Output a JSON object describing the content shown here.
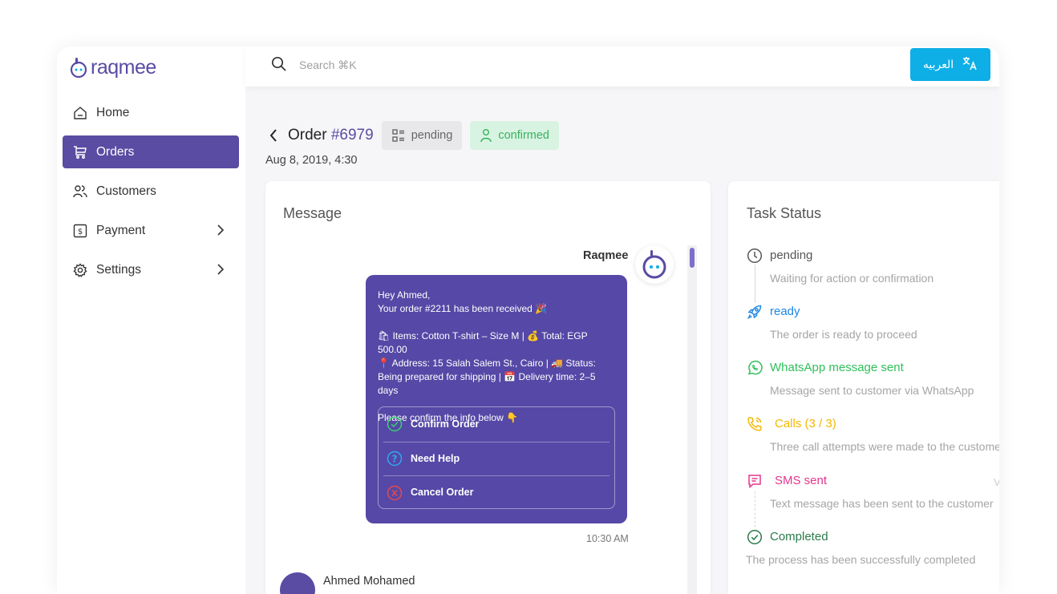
{
  "app": {
    "logo_text": "raqmee"
  },
  "sidebar": {
    "items": [
      {
        "label": "Home",
        "icon": "home-icon",
        "active": false
      },
      {
        "label": "Orders",
        "icon": "cart-icon",
        "active": true
      },
      {
        "label": "Customers",
        "icon": "users-icon",
        "active": false
      },
      {
        "label": "Payment",
        "icon": "dollar-receipt-icon",
        "active": false,
        "has_submenu": true
      },
      {
        "label": "Settings",
        "icon": "gear-icon",
        "active": false,
        "has_submenu": true
      }
    ]
  },
  "topbar": {
    "search_placeholder": "Search ⌘K",
    "language_button": "العربيه"
  },
  "order": {
    "title_prefix": "Order",
    "number": "#6979",
    "status_pending": "pending",
    "status_confirmed": "confirmed",
    "date": "Aug 8, 2019, 4:30"
  },
  "message_card": {
    "title": "Message",
    "sender": "Raqmee",
    "bubble": {
      "greeting": "Hey Ahmed,",
      "line1": "Your order #2211 has been received 🎉",
      "line2": "🛍 Items: Cotton T-shirt – Size M | 💰 Total: EGP 500.00",
      "line3": "📍 Address: 15 Salah Salem St., Cairo | 🚚 Status: Being prepared for shipping | 📅 Delivery time: 2–5 days",
      "line4": "Please confirm the info below 👇",
      "actions": [
        {
          "label": "Confirm Order",
          "icon": "check-circle-icon",
          "color": "#3ccf73"
        },
        {
          "label": "Need Help",
          "icon": "question-circle-icon",
          "color": "#2fa8ee"
        },
        {
          "label": "Cancel Order",
          "icon": "x-circle-icon",
          "color": "#e5484d"
        }
      ]
    },
    "time": "10:30 AM",
    "reply_author": "Ahmed Mohamed"
  },
  "task_card": {
    "title": "Task Status",
    "tasks": [
      {
        "label": "pending",
        "desc": "Waiting for action or confirmation",
        "icon": "clock-icon",
        "color": "#555555"
      },
      {
        "label": "ready",
        "desc": "The order is ready to proceed",
        "icon": "rocket-icon",
        "color": "#1e88e5"
      },
      {
        "label": "WhatsApp message sent",
        "desc": "Message sent to customer via WhatsApp",
        "icon": "whatsapp-icon",
        "color": "#2ec05a"
      },
      {
        "label": "Calls (3 / 3)",
        "desc": "Three call attempts were made to the customer",
        "icon": "phone-icon",
        "color": "#f2b705"
      },
      {
        "label": "SMS sent",
        "desc": "Text message has been sent to the customer",
        "icon": "sms-icon",
        "color": "#e5358b"
      },
      {
        "label": "Completed",
        "desc": "The process has been successfully completed",
        "icon": "check-circle-icon",
        "color": "#2a7a4a"
      }
    ],
    "side_mark": "V"
  },
  "colors": {
    "brand": "#5a4ba3",
    "accent": "#0eaee6",
    "bubble": "#5548a6"
  }
}
